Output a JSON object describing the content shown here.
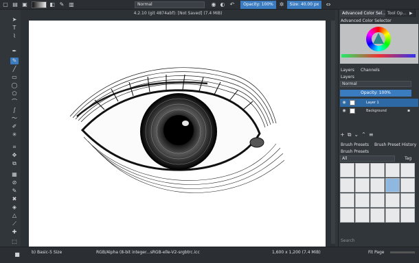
{
  "toolbar": {
    "blend_mode": "Normal",
    "opacity_label": "Opacity: 100%",
    "size_label": "Size: 40.00 px"
  },
  "canvas": {
    "title": "4.2.10 (git 4874abf): [Not Saved] (7.4 MiB)"
  },
  "docker": {
    "tabs": [
      "Advanced Color Sel...",
      "Tool Op...",
      "▶"
    ],
    "color_selector_title": "Advanced Color Selector",
    "layers_tabs": [
      "Layers",
      "Channels"
    ],
    "layers_title": "Layers",
    "layers_blend": "Normal",
    "layers_opacity": "Opacity: 100%",
    "layers": [
      {
        "name": "Layer 1",
        "selected": true
      },
      {
        "name": "Background",
        "selected": false
      }
    ],
    "brush_tabs": [
      "Brush Presets",
      "Brush Preset History"
    ],
    "brush_presets_title": "Brush Presets",
    "brush_filter": "All",
    "brush_tag": "Tag",
    "search_placeholder": "Search"
  },
  "status": {
    "brush": "b) Basic-5 Size",
    "color_space": "RGB/Alpha (8-bit integer...sRGB-elle-V2-srgbtrc.icc",
    "dimensions": "1,600 x 1,200 (7.4 MiB)",
    "zoom_mode": "Fit Page"
  },
  "colors": {
    "accent": "#3b7bbf",
    "panel": "#31363b"
  }
}
